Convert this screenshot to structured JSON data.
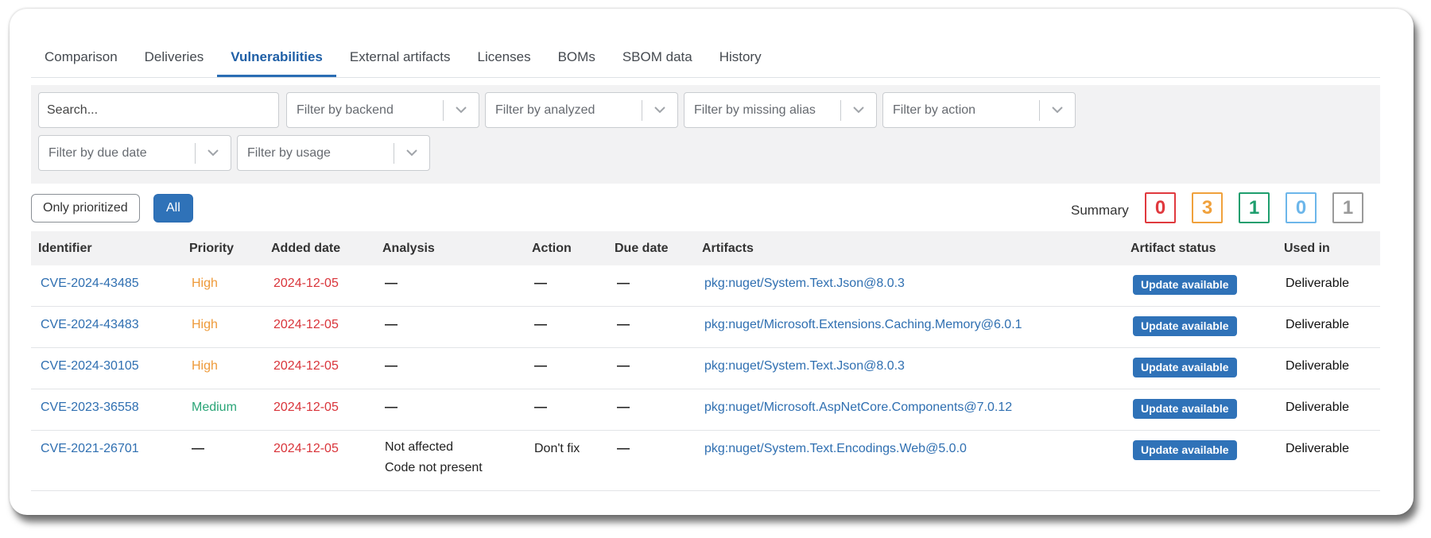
{
  "tabs": [
    {
      "label": "Comparison"
    },
    {
      "label": "Deliveries"
    },
    {
      "label": "Vulnerabilities"
    },
    {
      "label": "External artifacts"
    },
    {
      "label": "Licenses"
    },
    {
      "label": "BOMs"
    },
    {
      "label": "SBOM data"
    },
    {
      "label": "History"
    }
  ],
  "active_tab": "Vulnerabilities",
  "filters": {
    "search_placeholder": "Search...",
    "backend": "Filter by backend",
    "analyzed": "Filter by analyzed",
    "missing_alias": "Filter by missing alias",
    "action": "Filter by action",
    "due_date": "Filter by due date",
    "usage": "Filter by usage"
  },
  "toggle": {
    "only_prioritized": "Only prioritized",
    "all": "All"
  },
  "summary": {
    "label": "Summary",
    "counts": [
      {
        "value": "0",
        "color": "#e0393e"
      },
      {
        "value": "3",
        "color": "#f0a13c"
      },
      {
        "value": "1",
        "color": "#1e9e6e"
      },
      {
        "value": "0",
        "color": "#6cb6ea"
      },
      {
        "value": "1",
        "color": "#9a9a9a"
      }
    ]
  },
  "table": {
    "headers": {
      "identifier": "Identifier",
      "priority": "Priority",
      "added_date": "Added date",
      "analysis": "Analysis",
      "action": "Action",
      "due_date": "Due date",
      "artifacts": "Artifacts",
      "artifact_status": "Artifact status",
      "used_in": "Used in"
    },
    "rows": [
      {
        "identifier": "CVE-2024-43485",
        "priority": "High",
        "added_date": "2024-12-05",
        "analysis": "—",
        "action": "—",
        "due_date": "—",
        "artifact": "pkg:nuget/System.Text.Json@8.0.3",
        "status": "Update available",
        "used_in": "Deliverable"
      },
      {
        "identifier": "CVE-2024-43483",
        "priority": "High",
        "added_date": "2024-12-05",
        "analysis": "—",
        "action": "—",
        "due_date": "—",
        "artifact": "pkg:nuget/Microsoft.Extensions.Caching.Memory@6.0.1",
        "status": "Update available",
        "used_in": "Deliverable"
      },
      {
        "identifier": "CVE-2024-30105",
        "priority": "High",
        "added_date": "2024-12-05",
        "analysis": "—",
        "action": "—",
        "due_date": "—",
        "artifact": "pkg:nuget/System.Text.Json@8.0.3",
        "status": "Update available",
        "used_in": "Deliverable"
      },
      {
        "identifier": "CVE-2023-36558",
        "priority": "Medium",
        "added_date": "2024-12-05",
        "analysis": "—",
        "action": "—",
        "due_date": "—",
        "artifact": "pkg:nuget/Microsoft.AspNetCore.Components@7.0.12",
        "status": "Update available",
        "used_in": "Deliverable"
      },
      {
        "identifier": "CVE-2021-26701",
        "priority": "—",
        "added_date": "2024-12-05",
        "analysis": "Not affected",
        "analysis_detail": "Code not present",
        "action": "Don't fix",
        "due_date": "—",
        "artifact": "pkg:nuget/System.Text.Encodings.Web@5.0.0",
        "status": "Update available",
        "used_in": "Deliverable"
      }
    ]
  }
}
